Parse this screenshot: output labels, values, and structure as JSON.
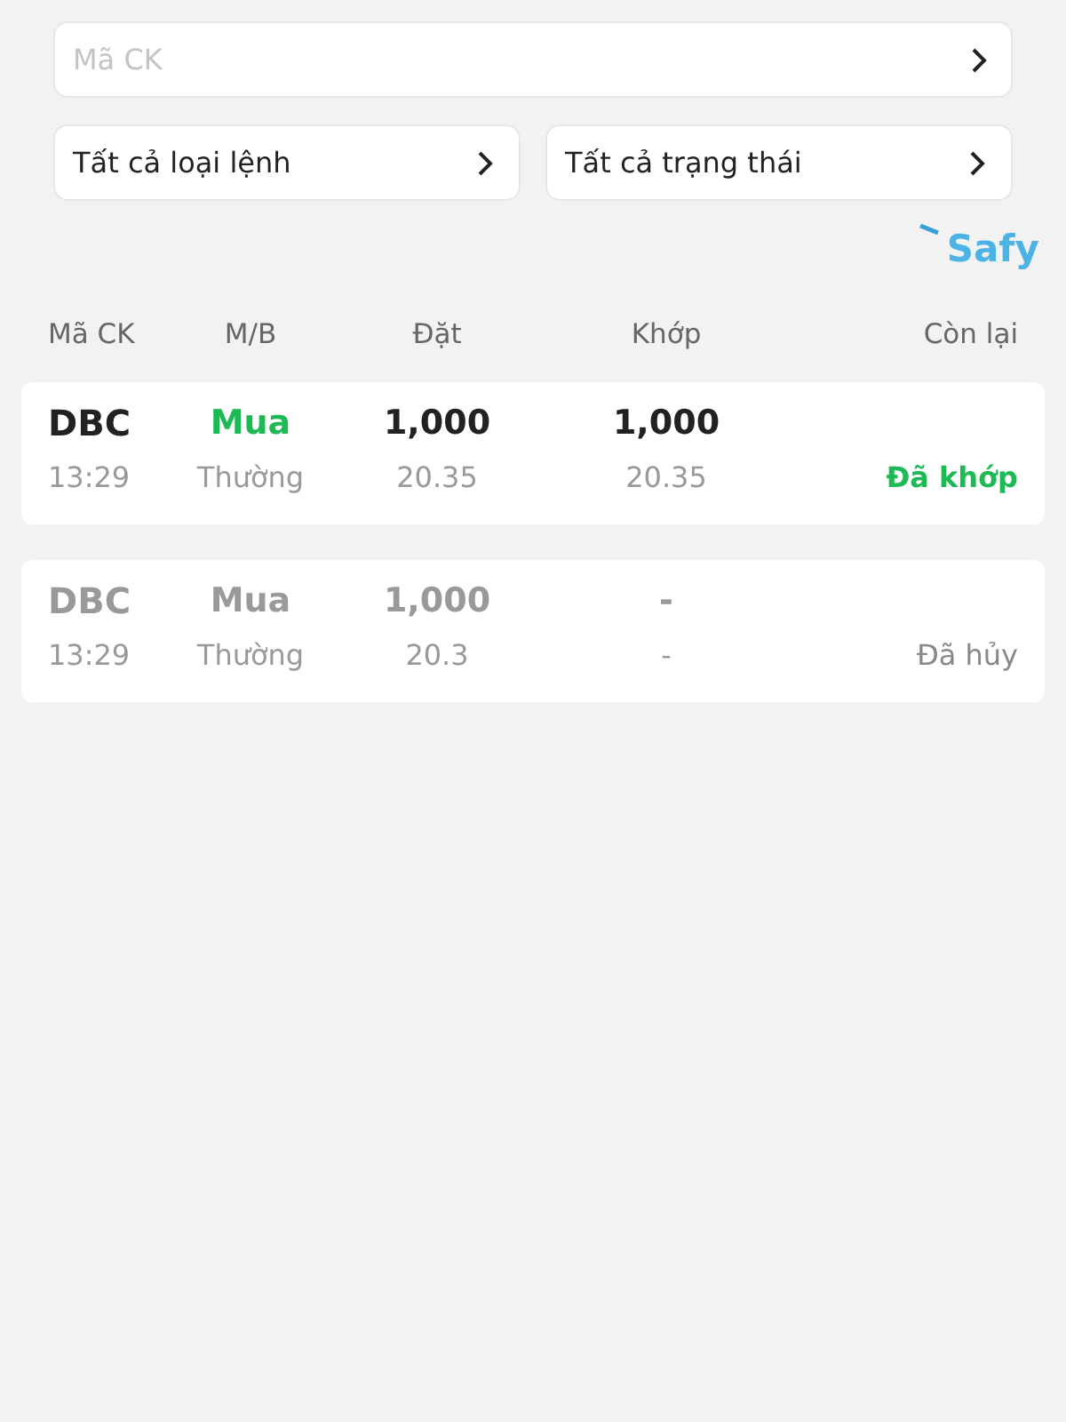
{
  "symbol_field": {
    "placeholder": "Mã CK"
  },
  "filters": [
    {
      "label": "Tất cả loại lệnh"
    },
    {
      "label": "Tất cả trạng thái"
    }
  ],
  "brand": {
    "name": "Safy"
  },
  "table": {
    "columns": [
      "Mã CK",
      "M/B",
      "Đặt",
      "Khớp",
      "Còn lại"
    ],
    "rows": [
      {
        "cancelled": false,
        "symbol": "DBC",
        "time": "13:29",
        "side": "Mua",
        "order_type": "Thường",
        "order_qty": "1,000",
        "order_price": "20.35",
        "match_qty": "1,000",
        "match_price": "20.35",
        "status": "Đã khớp"
      },
      {
        "cancelled": true,
        "symbol": "DBC",
        "time": "13:29",
        "side": "Mua",
        "order_type": "Thường",
        "order_qty": "1,000",
        "order_price": "20.3",
        "match_qty": "-",
        "match_price": "-",
        "status": "Đã hủy"
      }
    ]
  }
}
